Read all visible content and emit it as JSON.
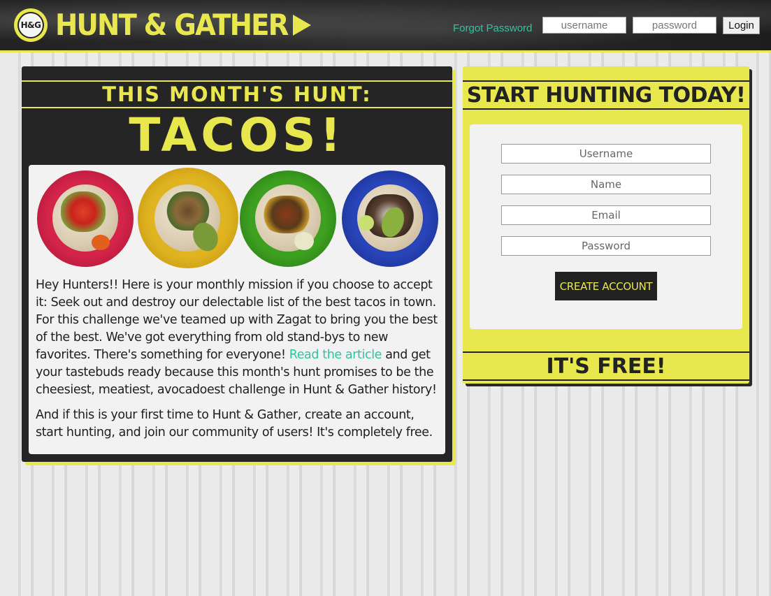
{
  "header": {
    "logo_badge": "H&G",
    "logo_text": "HUNT & GATHER",
    "forgot_password": "Forgot Password",
    "username_placeholder": "username",
    "password_placeholder": "password",
    "login_label": "Login"
  },
  "hunt": {
    "title": "THIS MONTH'S HUNT:",
    "subject": "TACOS!",
    "images": [
      "taco-plate-red",
      "taco-plate-yellow",
      "taco-plate-green",
      "taco-plate-blue"
    ],
    "paragraph1_before_link": "Hey Hunters!! Here is your monthly mission if you choose to accept it: Seek out and destroy our delectable list of the best tacos in town. For this challenge we've teamed up with Zagat to bring you the best of the best. We've got everything from old stand-bys to new favorites. There's something for everyone! ",
    "link_text": "Read the article",
    "paragraph1_after_link": " and get your tastebuds ready because this month's hunt promises to be the cheesiest, meatiest, avocadoest challenge in Hunt & Gather history!",
    "paragraph2": "And if this is your first time to Hunt & Gather, create an account, start hunting, and join our community of users! It's completely free."
  },
  "signup": {
    "title": "START HUNTING TODAY!",
    "username_placeholder": "Username",
    "name_placeholder": "Name",
    "email_placeholder": "Email",
    "password_placeholder": "Password",
    "button_label": "CREATE ACCOUNT",
    "free_text": "IT'S FREE!"
  },
  "colors": {
    "accent_yellow": "#e8e84e",
    "dark": "#252525",
    "link_teal": "#2ec4a0",
    "card_bg": "#f2f2f2"
  }
}
